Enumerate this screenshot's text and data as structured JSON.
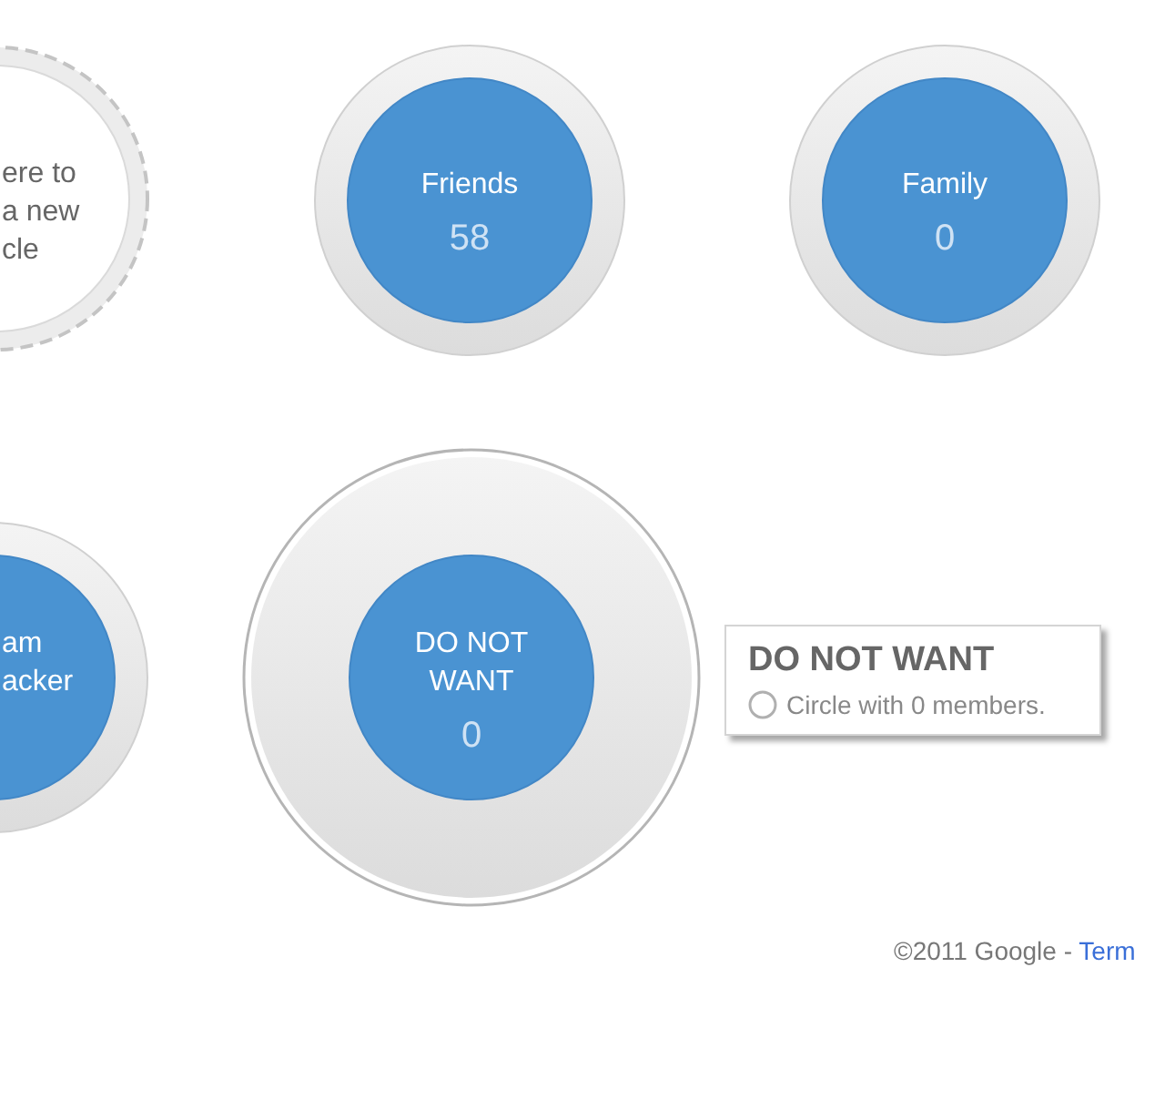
{
  "circles": [
    {
      "kind": "drop_zone",
      "text_lines": [
        "ere to",
        "a new",
        "cle"
      ]
    },
    {
      "kind": "circle",
      "name_lines": [
        "Friends"
      ],
      "count": "58",
      "expanded": false
    },
    {
      "kind": "circle",
      "name_lines": [
        "Family"
      ],
      "count": "0",
      "expanded": false
    },
    {
      "kind": "circle",
      "name_lines": [
        "am",
        "acker"
      ],
      "expanded": false
    },
    {
      "kind": "circle",
      "name_lines": [
        "DO NOT",
        "WANT"
      ],
      "count": "0",
      "expanded": true
    }
  ],
  "hover_card": {
    "title": "DO NOT WANT",
    "description": "Circle with 0 members."
  },
  "footer": {
    "copyright": "©2011 Google -",
    "link": "Term"
  }
}
